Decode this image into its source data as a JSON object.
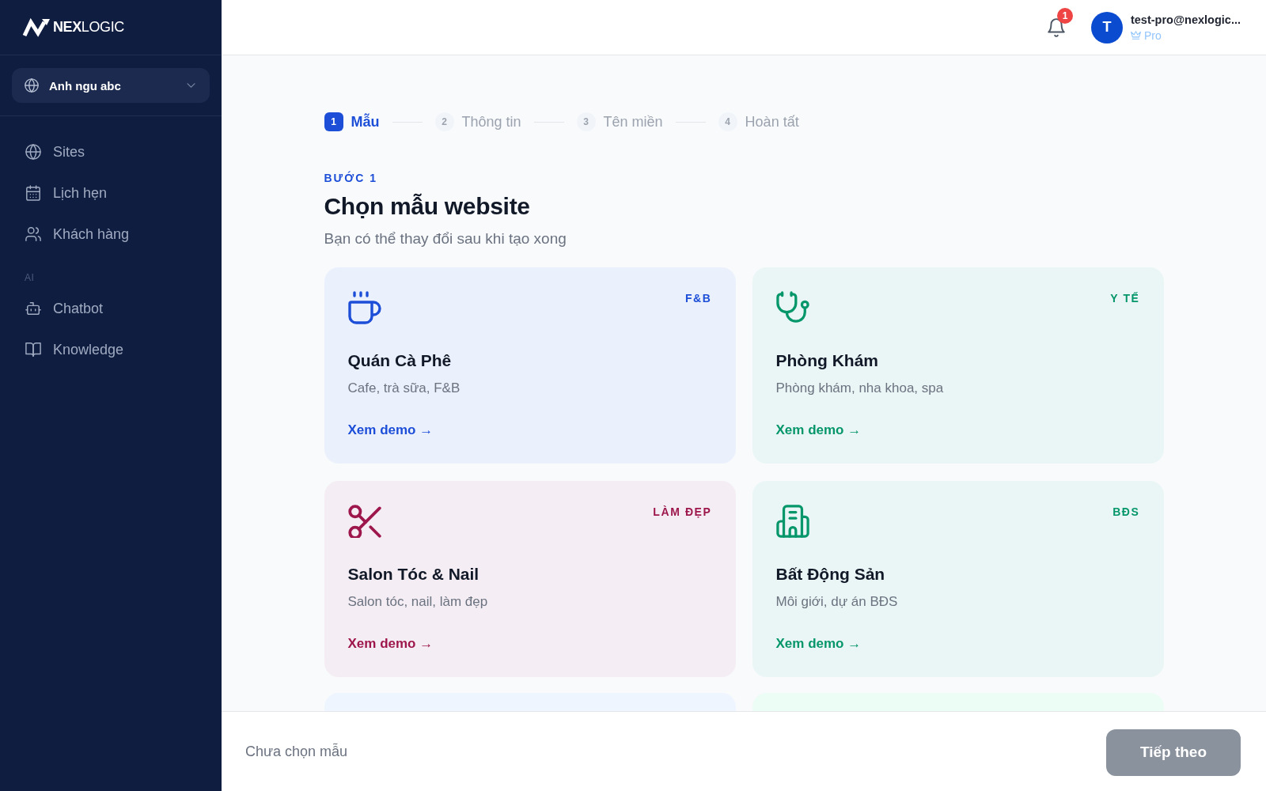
{
  "sidebar": {
    "logo": "**NEX**LOGIC",
    "workspace": {
      "name": "Anh ngu abc"
    },
    "sections": [
      {
        "items": [
          {
            "label": "Sites",
            "selected": false
          },
          {
            "label": "Lịch hẹn",
            "selected": false
          },
          {
            "label": "Khách hàng",
            "selected": false
          }
        ]
      },
      {
        "heading": "AI",
        "items": [
          {
            "label": "Chatbot",
            "selected": false
          },
          {
            "label": "Knowledge",
            "selected": false
          }
        ]
      }
    ]
  },
  "header": {
    "notifications": {
      "count": "1"
    },
    "user": {
      "initial": "T",
      "email": "test-pro@nexlogic...",
      "plan": "Pro"
    }
  },
  "stepper": [
    {
      "number": "1",
      "label": "Mẫu",
      "selected": true
    },
    {
      "number": "2",
      "label": "Thông tin",
      "selected": false
    },
    {
      "number": "3",
      "label": "Tên miền",
      "selected": false
    },
    {
      "number": "4",
      "label": "Hoàn tất",
      "selected": false
    }
  ],
  "step_label": "BƯỚC 1",
  "title": "Chọn mẫu website",
  "subtitle": "Bạn có thể thay đổi sau khi tạo xong",
  "cards": [
    {
      "tag": "F&B",
      "title": "Quán Cà Phê",
      "description": "Cafe, trà sữa, F&B",
      "link": "Xem demo →",
      "color": "#1d4ed8"
    },
    {
      "tag": "Y TẾ",
      "title": "Phòng Khám",
      "description": "Phòng khám, nha khoa, spa",
      "link": "Xem demo →",
      "color": "#059669"
    },
    {
      "tag": "LÀM ĐẸP",
      "title": "Salon Tóc & Nail",
      "description": "Salon tóc, nail, làm đẹp",
      "link": "Xem demo →",
      "color": "#9d174d"
    },
    {
      "tag": "BĐS",
      "title": "Bất Động Sản",
      "description": "Môi giới, dự án BĐS",
      "link": "Xem demo →",
      "color": "#059669"
    }
  ],
  "cut_off_cards": [
    {
      "color": "#eef5ff"
    },
    {
      "color": "#ecfdf5"
    }
  ],
  "footer": {
    "status": "Chưa chọn mẫu",
    "next_button": {
      "label": "Tiếp theo",
      "disabled": true
    }
  }
}
